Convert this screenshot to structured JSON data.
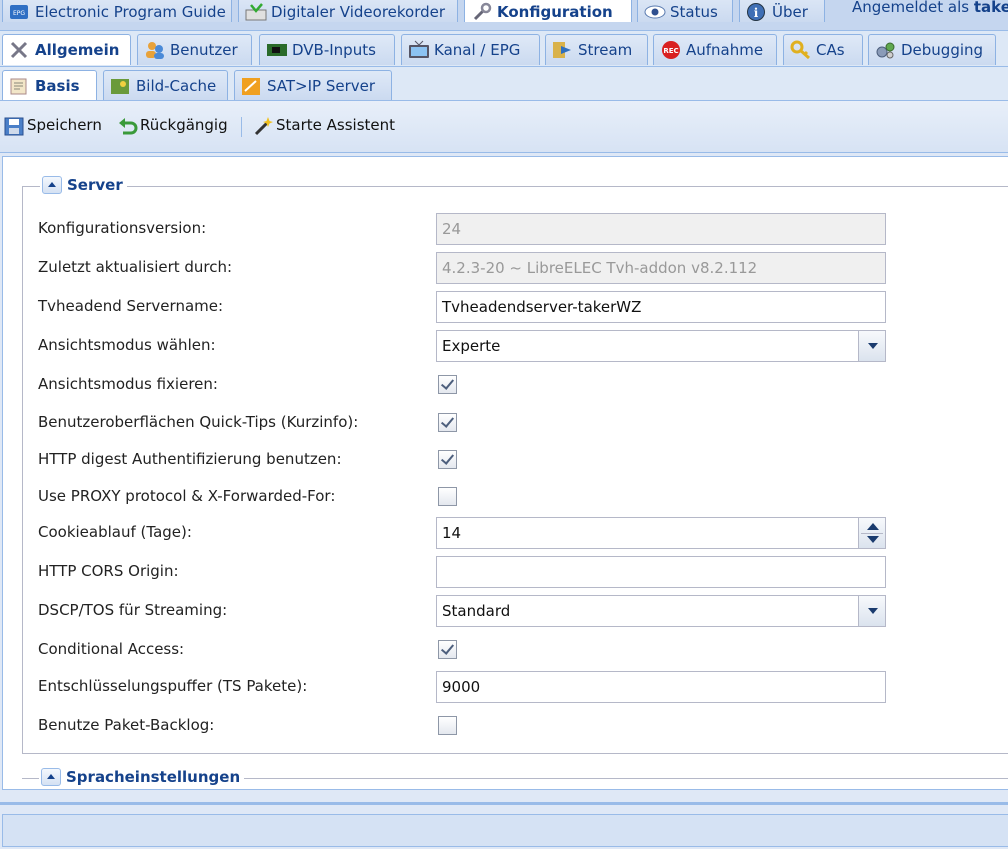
{
  "main_tabs": [
    {
      "label": "Electronic Program Guide",
      "icon": "epg-icon"
    },
    {
      "label": "Digitaler Videorekorder",
      "icon": "dvr-icon"
    },
    {
      "label": "Konfiguration",
      "icon": "wrench-icon",
      "active": true
    },
    {
      "label": "Status",
      "icon": "eye-icon"
    },
    {
      "label": "Über",
      "icon": "info-icon"
    }
  ],
  "logged_in": {
    "prefix": "Angemeldet als ",
    "user": "taker"
  },
  "config_tabs": [
    {
      "label": "Allgemein",
      "icon": "tools-icon",
      "active": true
    },
    {
      "label": "Benutzer",
      "icon": "users-icon"
    },
    {
      "label": "DVB-Inputs",
      "icon": "dvb-card-icon"
    },
    {
      "label": "Kanal / EPG",
      "icon": "tv-icon"
    },
    {
      "label": "Stream",
      "icon": "stream-icon"
    },
    {
      "label": "Aufnahme",
      "icon": "rec-icon"
    },
    {
      "label": "CAs",
      "icon": "key-icon"
    },
    {
      "label": "Debugging",
      "icon": "gears-icon"
    }
  ],
  "sub_tabs": [
    {
      "label": "Basis",
      "icon": "basis-icon",
      "active": true
    },
    {
      "label": "Bild-Cache",
      "icon": "image-cache-icon"
    },
    {
      "label": "SAT>IP Server",
      "icon": "satip-icon"
    }
  ],
  "toolbar": {
    "save": "Speichern",
    "undo": "Rückgängig",
    "wizard": "Starte Assistent"
  },
  "server_section": {
    "title": "Server",
    "fields": {
      "config_version": {
        "label": "Konfigurationsversion:",
        "value": "24"
      },
      "last_updated_by": {
        "label": "Zuletzt aktualisiert durch:",
        "value": "4.2.3-20 ~ LibreELEC Tvh-addon v8.2.112"
      },
      "server_name": {
        "label": "Tvheadend Servername:",
        "value": "Tvheadendserver-takerWZ"
      },
      "view_mode": {
        "label": "Ansichtsmodus wählen:",
        "value": "Experte"
      },
      "view_mode_fixed": {
        "label": "Ansichtsmodus fixieren:",
        "checked": true
      },
      "quick_tips": {
        "label": "Benutzeroberflächen Quick-Tips (Kurzinfo):",
        "checked": true
      },
      "http_digest": {
        "label": "HTTP digest Authentifizierung benutzen:",
        "checked": true
      },
      "proxy_protocol": {
        "label": "Use PROXY protocol & X-Forwarded-For:",
        "checked": false
      },
      "cookie_expiry": {
        "label": "Cookieablauf (Tage):",
        "value": "14"
      },
      "cors_origin": {
        "label": "HTTP CORS Origin:",
        "value": ""
      },
      "dscp_tos": {
        "label": "DSCP/TOS für Streaming:",
        "value": "Standard"
      },
      "conditional_access": {
        "label": "Conditional Access:",
        "checked": true
      },
      "descrambler_buffer": {
        "label": "Entschlüsselungspuffer (TS Pakete):",
        "value": "9000"
      },
      "packet_backlog": {
        "label": "Benutze Paket-Backlog:",
        "checked": false
      }
    }
  },
  "language_section": {
    "title": "Spracheinstellungen"
  }
}
